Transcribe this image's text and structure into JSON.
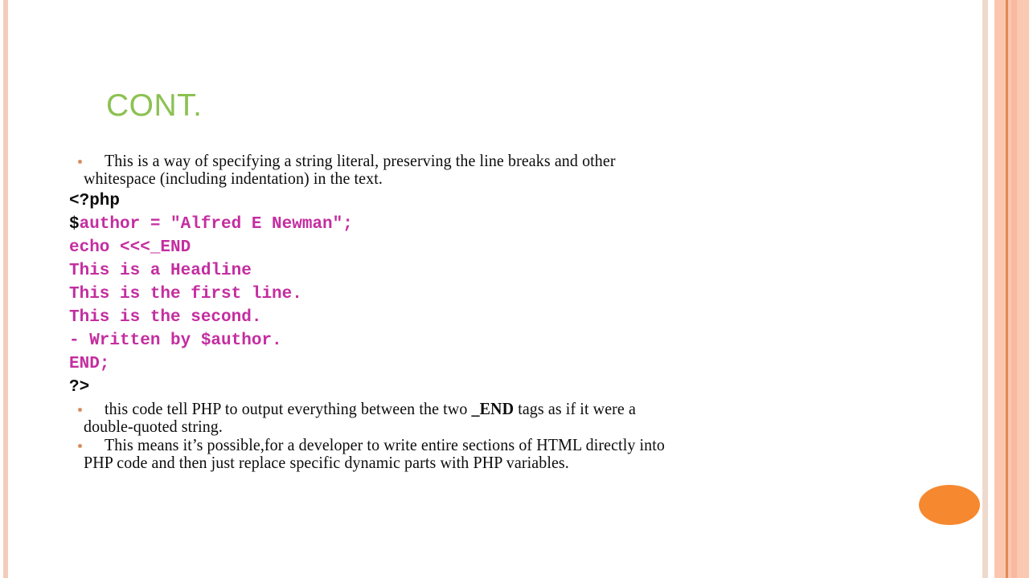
{
  "slide": {
    "title": "CONT.",
    "title_color": "#8CC152",
    "background_color": "#FFFFFF",
    "body_text_color": "#0D0D0D",
    "code_color": "#C42DA0",
    "code_dark_color": "#0D0D0D",
    "bullet_color": "#D98E5A",
    "accent_ellipse_color": "#F6882F",
    "border_colors": {
      "left_rule": "#F4CBBB",
      "stripe_pale": "#EFD9CD",
      "stripe_pink": "#FAC6AE",
      "stripe_orange_line": "#E08B55",
      "stripe_salmon": "#F9B9A0",
      "stripe_pink_wide": "#FBC8B2"
    }
  },
  "content": {
    "bullet_top": {
      "line1": "This is a way of specifying a string literal, preserving the line breaks and other",
      "line2": "whitespace (including indentation) in the text."
    },
    "code": {
      "lines": [
        {
          "text": "<?php",
          "style": "dark"
        },
        {
          "prefix": "$",
          "text": "author = \"Alfred E Newman\";",
          "style": "mixed"
        },
        {
          "text": "echo <<<_END",
          "style": "code"
        },
        {
          "text": "This is a Headline",
          "style": "code"
        },
        {
          "text": "This is the first line.",
          "style": "code"
        },
        {
          "text": "This is the second.",
          "style": "code"
        },
        {
          "text": "- Written by $author.",
          "style": "code"
        },
        {
          "text": "END;",
          "style": "code"
        },
        {
          "text": "?>",
          "style": "dark"
        }
      ]
    },
    "bullet_mid": {
      "pre": "this code  tell PHP to output everything between the two ",
      "bold": "_END",
      "post": " tags as if it were a",
      "line2": "double-quoted string."
    },
    "bullet_bottom": {
      "line1": "This means it’s possible,for a developer to write entire sections of HTML directly into",
      "line2": "PHP code and then just replace specific dynamic parts with PHP variables."
    }
  }
}
